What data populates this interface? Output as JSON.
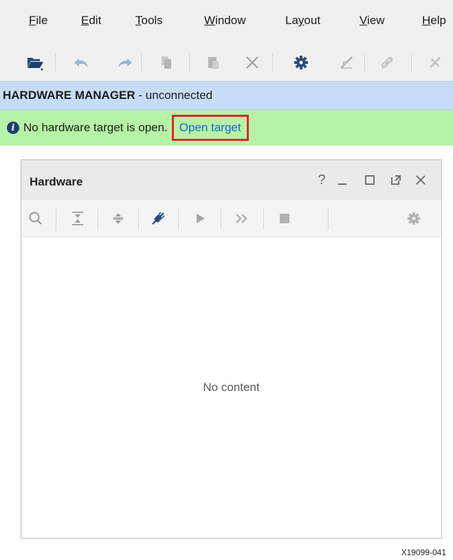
{
  "menu": {
    "items": [
      {
        "mnemonic": "F",
        "rest": "ile"
      },
      {
        "mnemonic": "E",
        "rest": "dit"
      },
      {
        "mnemonic": "T",
        "rest": "ools"
      },
      {
        "mnemonic": "W",
        "rest": "indow"
      },
      {
        "pre": "La",
        "mnemonic": "y",
        "rest": "out"
      },
      {
        "mnemonic": "V",
        "rest": "iew"
      },
      {
        "mnemonic": "H",
        "rest": "elp"
      }
    ]
  },
  "toolbar": {
    "icons": [
      "open-project-icon",
      "undo-icon",
      "redo-icon",
      "copy-icon",
      "paste-icon",
      "delete-icon",
      "settings-icon",
      "auto-connect-icon",
      "link-icon",
      "disconnect-icon"
    ]
  },
  "manager": {
    "title_bold": "HARDWARE MANAGER",
    "title_rest": " - unconnected"
  },
  "status": {
    "message": "No hardware target is open.",
    "link": "Open target"
  },
  "hardware_panel": {
    "title": "Hardware",
    "help": "?",
    "empty_text": "No content",
    "icons": [
      "search-icon",
      "collapse-all-icon",
      "expand-all-icon",
      "auto-connect-icon",
      "run-icon",
      "run-all-icon",
      "stop-icon",
      "settings-icon"
    ]
  },
  "figure_id": "X19099-041",
  "colors": {
    "manager_header_bg": "#c9dcf7",
    "status_bg": "#b7f3a6",
    "link": "#1a63c9",
    "highlight_box": "#e0242a"
  }
}
